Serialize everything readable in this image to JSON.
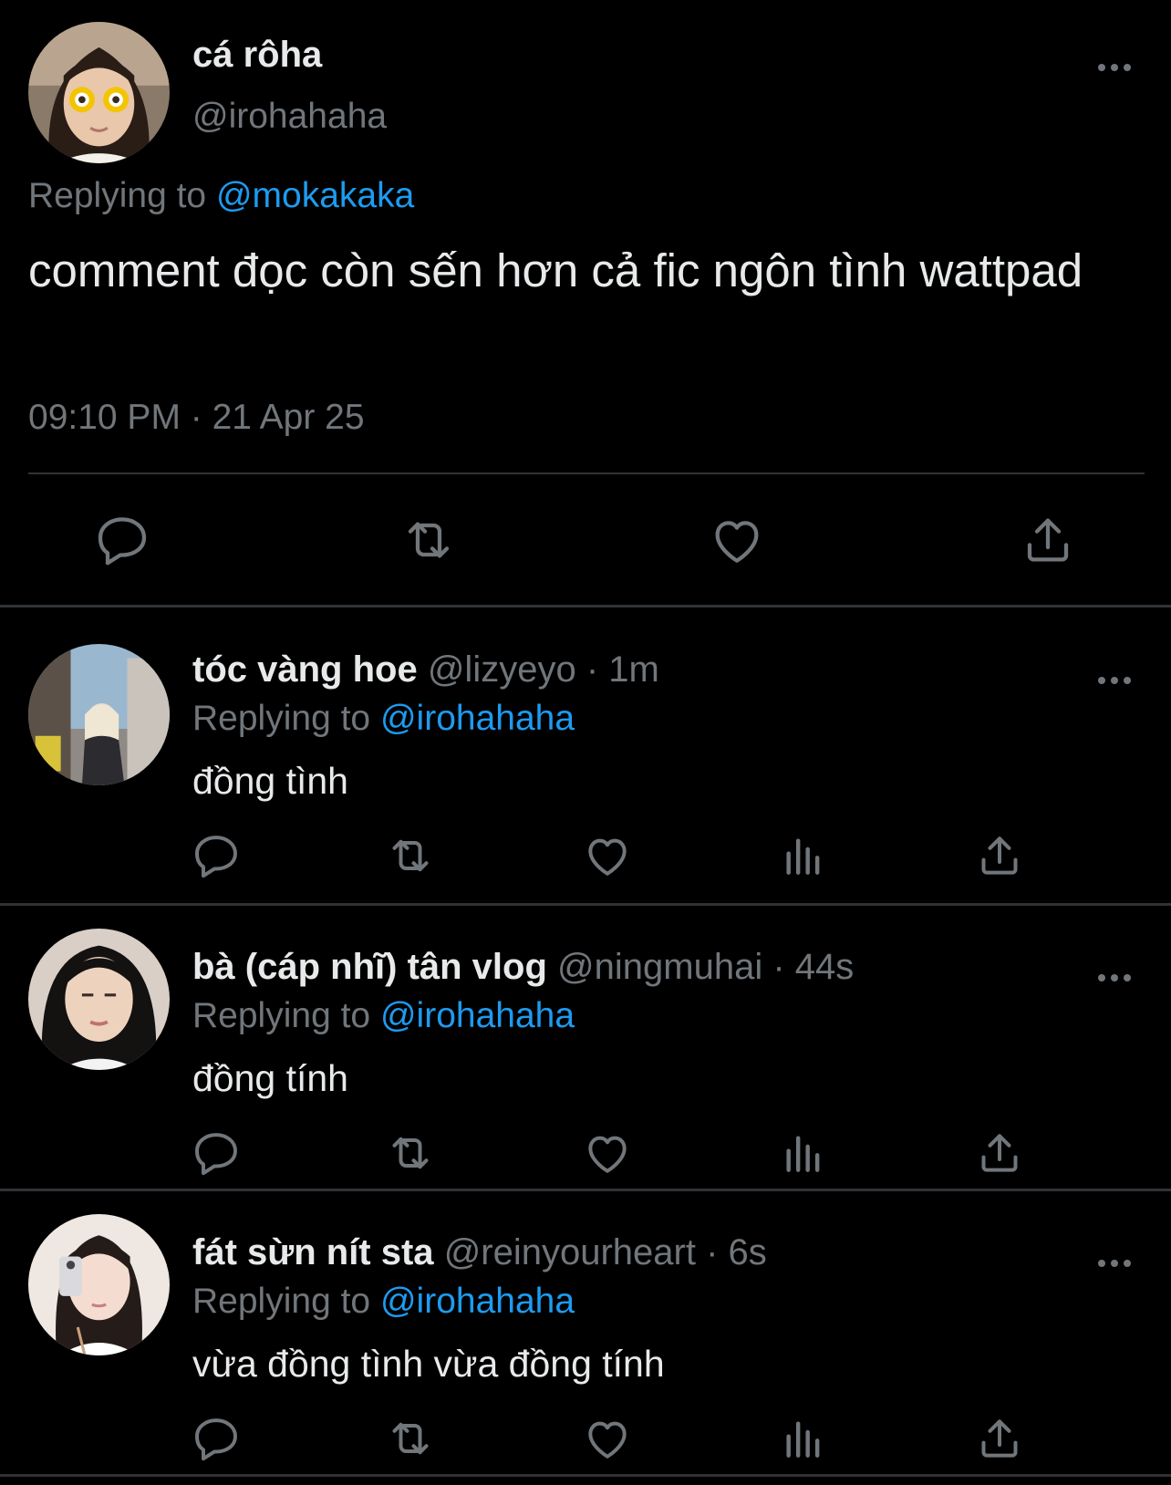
{
  "main_tweet": {
    "display_name": "cá rôha",
    "handle": "@irohahaha",
    "replying_prefix": "Replying to ",
    "replying_to": "@mokakaka",
    "text": "comment đọc còn sến hơn cả fic ngôn tình wattpad",
    "timestamp": "09:10 PM · 21 Apr 25",
    "actions": [
      "reply-icon",
      "retweet-icon",
      "like-icon",
      "share-icon"
    ]
  },
  "replies": [
    {
      "display_name": "tóc vàng hoe",
      "handle": "@lizyeyo · 1m",
      "replying_prefix": "Replying to ",
      "replying_to": "@irohahaha",
      "text": "đồng tình"
    },
    {
      "display_name": "bà (cáp nhĩ) tân vlog",
      "handle": "@ningmuhai · 44s",
      "replying_prefix": "Replying to ",
      "replying_to": "@irohahaha",
      "text": "đồng tính"
    },
    {
      "display_name": "fát sừn nít sta",
      "handle": "@reinyourheart · 6s",
      "replying_prefix": "Replying to ",
      "replying_to": "@irohahaha",
      "text": "vừa đồng tình vừa đồng tính"
    }
  ],
  "reply_actions": [
    "reply-icon",
    "retweet-icon",
    "like-icon",
    "views-icon",
    "share-icon"
  ],
  "colors": {
    "background": "#000000",
    "text": "#e7e9ea",
    "secondary": "#71767b",
    "mention": "#1d9bf0",
    "divider": "#2f3336"
  }
}
